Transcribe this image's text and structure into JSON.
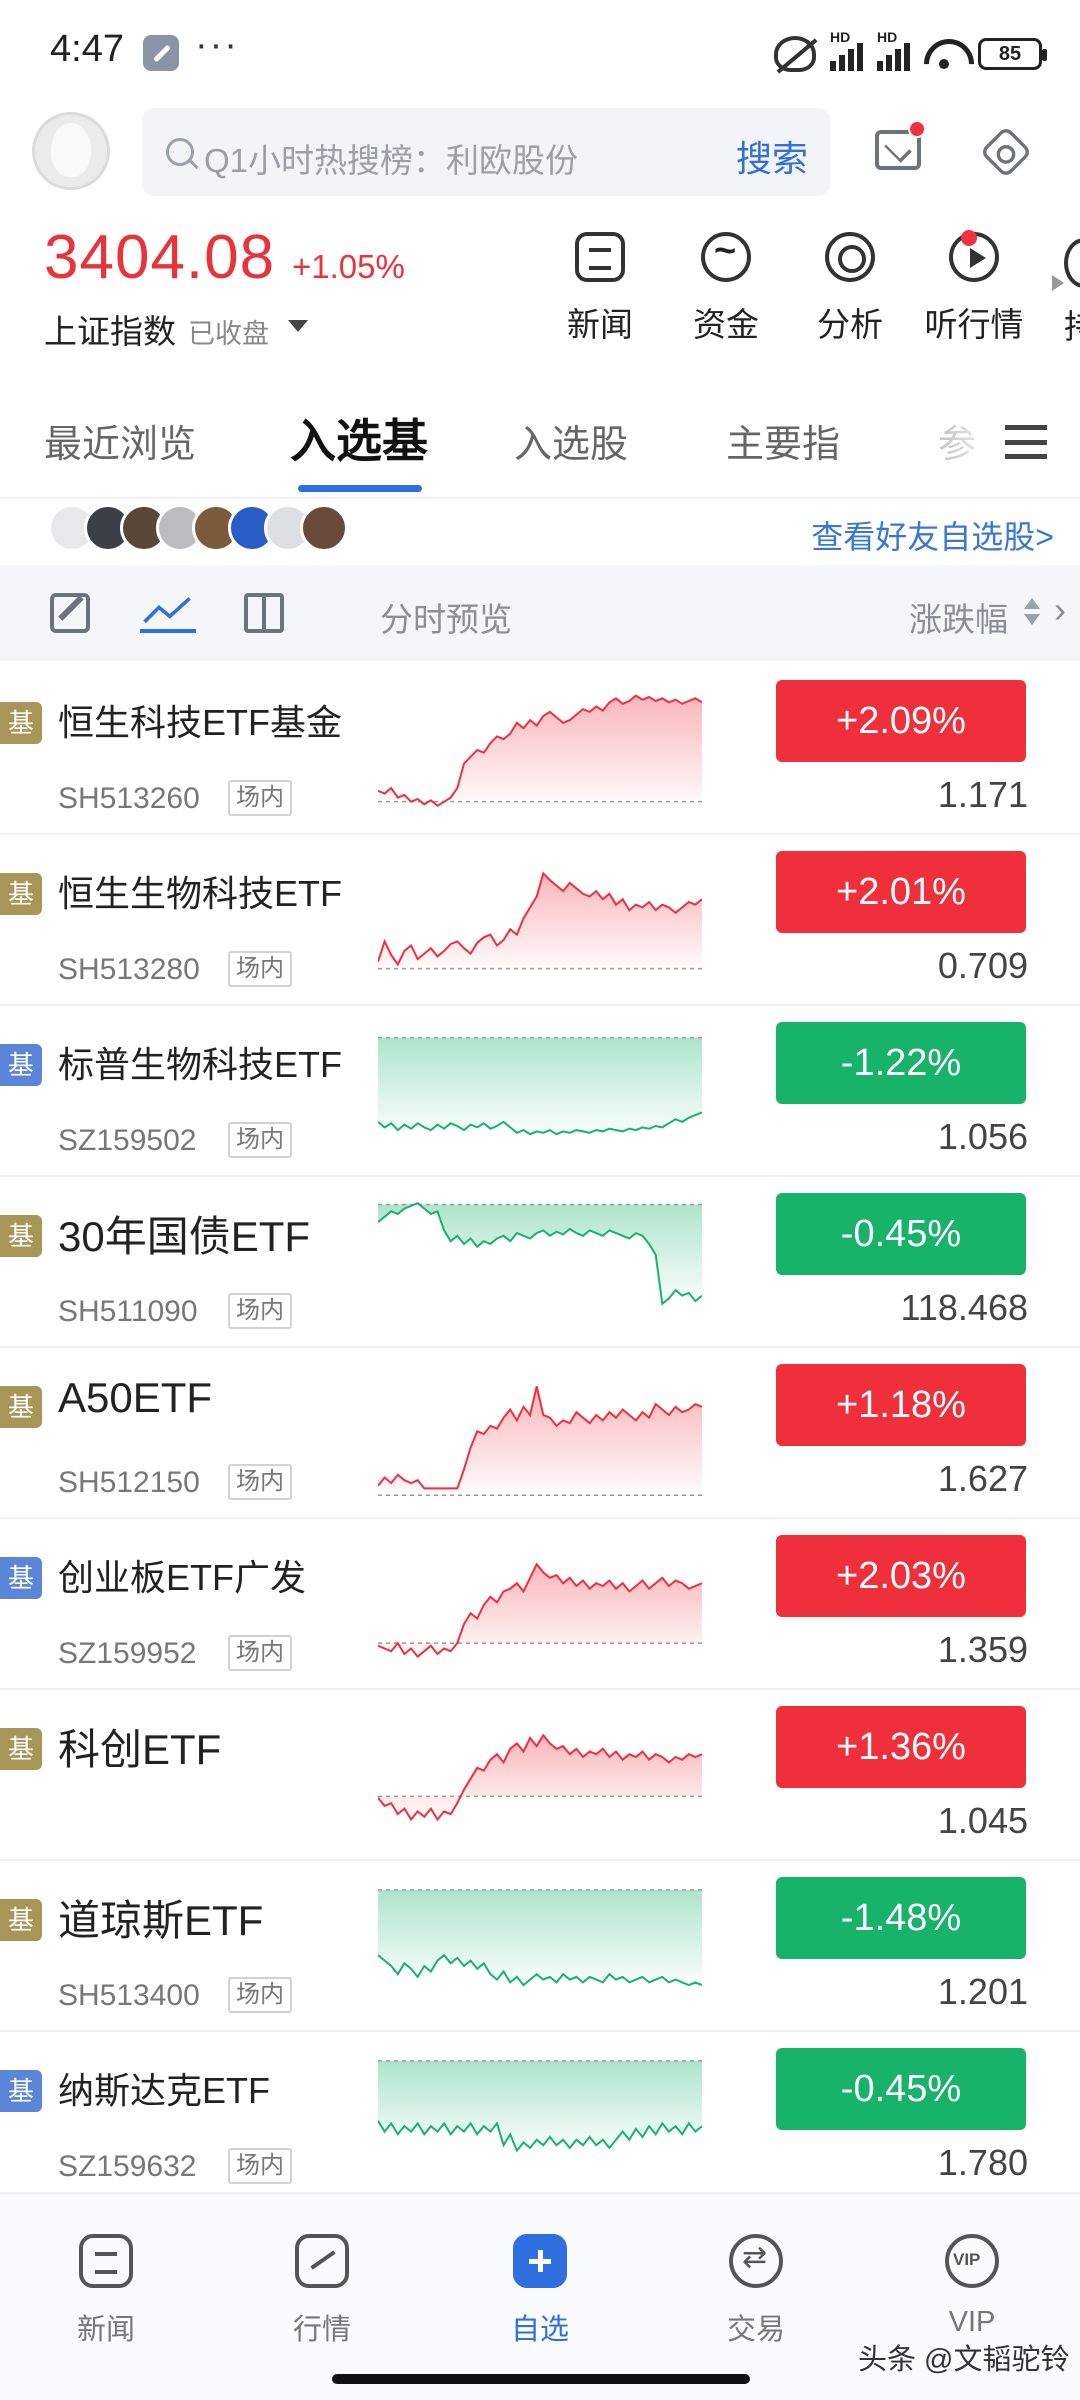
{
  "status_bar": {
    "time": "4:47",
    "dots": "···",
    "hd": "HD",
    "battery": "85"
  },
  "header": {
    "search_placeholder": "Q1小时热搜榜：利欧股份",
    "search_button": "搜索"
  },
  "index": {
    "value": "3404.08",
    "change": "+1.05%",
    "name": "上证指数",
    "status": "已收盘"
  },
  "quick_nav": [
    {
      "label": "新闻",
      "icon": "news-icon"
    },
    {
      "label": "资金",
      "icon": "fund-flow-icon"
    },
    {
      "label": "分析",
      "icon": "analysis-icon"
    },
    {
      "label": "听行情",
      "icon": "listen-icon"
    }
  ],
  "quick_nav_cut_label": "持",
  "tabs": [
    "最近浏览",
    "入选基",
    "入选股",
    "主要指",
    "参"
  ],
  "friends": {
    "link": "查看好友自选股>",
    "avatar_colors": [
      "#e6e8ea",
      "#3b3f46",
      "#5a4636",
      "#b9bdc2",
      "#7b5b3a",
      "#2a5cc8",
      "#dcdfe3",
      "#6a4a3a"
    ]
  },
  "toolbar": {
    "label": "分时预览",
    "sort_label": "涨跌幅"
  },
  "rows": [
    {
      "badge": "基",
      "badge_color": "#a89659",
      "name": "恒生科技ETF基金",
      "code": "SH513260",
      "tag": "场内",
      "pct": "+2.09%",
      "price": "1.171",
      "dir": "up",
      "spark": [
        0.2,
        0.18,
        0.22,
        0.15,
        0.17,
        0.12,
        0.14,
        0.1,
        0.13,
        0.09,
        0.12,
        0.15,
        0.22,
        0.4,
        0.45,
        0.5,
        0.48,
        0.55,
        0.6,
        0.58,
        0.62,
        0.7,
        0.66,
        0.72,
        0.68,
        0.75,
        0.78,
        0.74,
        0.7,
        0.72,
        0.76,
        0.8,
        0.78,
        0.82,
        0.79,
        0.85,
        0.88,
        0.84,
        0.86,
        0.9,
        0.87,
        0.89,
        0.86,
        0.88,
        0.85,
        0.87,
        0.84,
        0.86,
        0.88,
        0.85
      ],
      "base": 0.12
    },
    {
      "badge": "基",
      "badge_color": "#a89659",
      "name": "恒生生物科技ETF",
      "code": "SH513280",
      "tag": "场内",
      "pct": "+2.01%",
      "price": "0.709",
      "dir": "up",
      "spark": [
        0.2,
        0.35,
        0.25,
        0.18,
        0.28,
        0.32,
        0.22,
        0.26,
        0.3,
        0.24,
        0.28,
        0.33,
        0.35,
        0.3,
        0.26,
        0.34,
        0.38,
        0.4,
        0.32,
        0.36,
        0.44,
        0.4,
        0.52,
        0.6,
        0.68,
        0.85,
        0.8,
        0.76,
        0.72,
        0.78,
        0.74,
        0.7,
        0.68,
        0.72,
        0.66,
        0.7,
        0.62,
        0.66,
        0.58,
        0.62,
        0.6,
        0.64,
        0.58,
        0.62,
        0.6,
        0.56,
        0.6,
        0.64,
        0.62,
        0.66
      ],
      "base": 0.15
    },
    {
      "badge": "基",
      "badge_color": "#5b86d8",
      "name": "标普生物科技ETF",
      "code": "SZ159502",
      "tag": "场内",
      "pct": "-1.22%",
      "price": "1.056",
      "dir": "down",
      "spark": [
        0.28,
        0.24,
        0.27,
        0.22,
        0.26,
        0.23,
        0.27,
        0.24,
        0.22,
        0.26,
        0.23,
        0.27,
        0.25,
        0.22,
        0.26,
        0.24,
        0.27,
        0.23,
        0.25,
        0.28,
        0.24,
        0.2,
        0.22,
        0.19,
        0.21,
        0.2,
        0.22,
        0.19,
        0.21,
        0.2,
        0.22,
        0.21,
        0.2,
        0.22,
        0.21,
        0.23,
        0.22,
        0.21,
        0.23,
        0.22,
        0.24,
        0.23,
        0.25,
        0.24,
        0.27,
        0.3,
        0.28,
        0.31,
        0.33,
        0.35
      ],
      "base": 0.9
    },
    {
      "badge": "基",
      "badge_color": "#a89659",
      "name": "30年国债ETF",
      "code": "SH511090",
      "tag": "场内",
      "pct": "-0.45%",
      "price": "118.468",
      "dir": "down",
      "spark": [
        0.8,
        0.84,
        0.88,
        0.86,
        0.9,
        0.92,
        0.94,
        0.9,
        0.86,
        0.88,
        0.74,
        0.66,
        0.7,
        0.64,
        0.68,
        0.62,
        0.66,
        0.64,
        0.68,
        0.7,
        0.66,
        0.72,
        0.7,
        0.68,
        0.72,
        0.74,
        0.7,
        0.73,
        0.71,
        0.75,
        0.72,
        0.7,
        0.74,
        0.72,
        0.7,
        0.74,
        0.72,
        0.7,
        0.68,
        0.72,
        0.7,
        0.64,
        0.56,
        0.2,
        0.24,
        0.3,
        0.26,
        0.28,
        0.22,
        0.26
      ],
      "base": 0.93
    },
    {
      "badge": "基",
      "badge_color": "#a89659",
      "name": "A50ETF",
      "code": "SH512150",
      "tag": "场内",
      "pct": "+1.18%",
      "price": "1.627",
      "dir": "up",
      "spark": [
        0.12,
        0.18,
        0.14,
        0.2,
        0.16,
        0.14,
        0.16,
        0.1,
        0.1,
        0.1,
        0.1,
        0.1,
        0.1,
        0.24,
        0.4,
        0.52,
        0.5,
        0.56,
        0.54,
        0.62,
        0.68,
        0.6,
        0.7,
        0.64,
        0.85,
        0.64,
        0.62,
        0.56,
        0.6,
        0.58,
        0.66,
        0.62,
        0.58,
        0.64,
        0.6,
        0.66,
        0.62,
        0.68,
        0.64,
        0.6,
        0.66,
        0.62,
        0.72,
        0.68,
        0.64,
        0.7,
        0.66,
        0.68,
        0.72,
        0.7
      ],
      "base": 0.05
    },
    {
      "badge": "基",
      "badge_color": "#5b86d8",
      "name": "创业板ETF广发",
      "code": "SZ159952",
      "tag": "场内",
      "pct": "+2.03%",
      "price": "1.359",
      "dir": "up",
      "spark": [
        0.2,
        0.18,
        0.16,
        0.22,
        0.14,
        0.18,
        0.12,
        0.16,
        0.2,
        0.14,
        0.18,
        0.16,
        0.22,
        0.36,
        0.44,
        0.4,
        0.5,
        0.56,
        0.52,
        0.6,
        0.62,
        0.66,
        0.6,
        0.7,
        0.8,
        0.74,
        0.7,
        0.72,
        0.66,
        0.7,
        0.64,
        0.68,
        0.62,
        0.66,
        0.64,
        0.68,
        0.62,
        0.66,
        0.6,
        0.64,
        0.68,
        0.62,
        0.66,
        0.7,
        0.64,
        0.68,
        0.66,
        0.62,
        0.64,
        0.66
      ],
      "base": 0.22
    },
    {
      "badge": "基",
      "badge_color": "#a89659",
      "name": "科创ETF",
      "code": "",
      "tag": "",
      "pct": "+1.36%",
      "price": "1.045",
      "dir": "up",
      "spark": [
        0.34,
        0.28,
        0.3,
        0.22,
        0.26,
        0.18,
        0.24,
        0.2,
        0.26,
        0.18,
        0.24,
        0.22,
        0.3,
        0.4,
        0.48,
        0.56,
        0.54,
        0.62,
        0.66,
        0.6,
        0.7,
        0.74,
        0.68,
        0.78,
        0.72,
        0.8,
        0.74,
        0.7,
        0.72,
        0.66,
        0.7,
        0.64,
        0.68,
        0.66,
        0.7,
        0.64,
        0.68,
        0.62,
        0.66,
        0.64,
        0.68,
        0.62,
        0.66,
        0.64,
        0.6,
        0.64,
        0.62,
        0.66,
        0.64,
        0.66
      ],
      "base": 0.35
    },
    {
      "badge": "基",
      "badge_color": "#a89659",
      "name": "道琼斯ETF",
      "code": "SH513400",
      "tag": "场内",
      "pct": "-1.48%",
      "price": "1.201",
      "dir": "down",
      "spark": [
        0.44,
        0.4,
        0.36,
        0.3,
        0.38,
        0.34,
        0.28,
        0.36,
        0.32,
        0.4,
        0.44,
        0.38,
        0.42,
        0.36,
        0.4,
        0.34,
        0.38,
        0.3,
        0.26,
        0.32,
        0.24,
        0.28,
        0.22,
        0.26,
        0.3,
        0.26,
        0.28,
        0.24,
        0.3,
        0.26,
        0.28,
        0.24,
        0.28,
        0.26,
        0.24,
        0.3,
        0.26,
        0.28,
        0.24,
        0.26,
        0.28,
        0.24,
        0.26,
        0.28,
        0.24,
        0.26,
        0.24,
        0.22,
        0.24,
        0.22
      ],
      "base": 0.92
    },
    {
      "badge": "基",
      "badge_color": "#5b86d8",
      "name": "纳斯达克ETF",
      "code": "SZ159632",
      "tag": "场内",
      "pct": "-0.45%",
      "price": "1.780",
      "dir": "down",
      "spark": [
        0.48,
        0.4,
        0.46,
        0.38,
        0.44,
        0.4,
        0.46,
        0.38,
        0.44,
        0.4,
        0.46,
        0.38,
        0.44,
        0.4,
        0.46,
        0.38,
        0.44,
        0.4,
        0.46,
        0.3,
        0.38,
        0.26,
        0.32,
        0.28,
        0.34,
        0.3,
        0.36,
        0.3,
        0.34,
        0.28,
        0.34,
        0.3,
        0.36,
        0.3,
        0.34,
        0.28,
        0.34,
        0.4,
        0.34,
        0.42,
        0.36,
        0.44,
        0.38,
        0.46,
        0.4,
        0.44,
        0.38,
        0.46,
        0.4,
        0.44
      ],
      "base": 0.92
    }
  ],
  "bottom_nav": [
    {
      "label": "新闻",
      "icon": "news-icon"
    },
    {
      "label": "行情",
      "icon": "market-icon"
    },
    {
      "label": "自选",
      "icon": "watchlist-icon"
    },
    {
      "label": "交易",
      "icon": "trade-icon"
    },
    {
      "label": "VIP",
      "icon": "vip-icon"
    }
  ],
  "watermark": "头条 @文韬驼铃",
  "colors": {
    "up": "#ef2f3c",
    "down": "#17b36b",
    "accent": "#2f6fe0"
  }
}
